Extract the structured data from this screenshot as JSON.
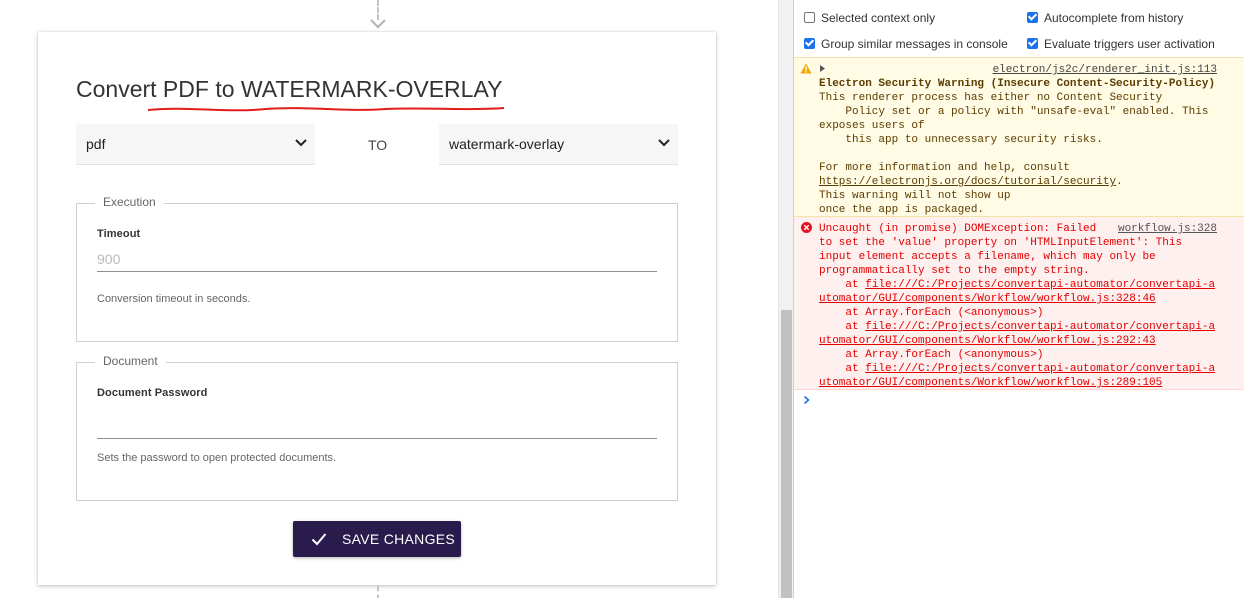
{
  "app": {
    "card_title": "Convert PDF to WATERMARK-OVERLAY",
    "from_format": "pdf",
    "to_label": "TO",
    "to_format": "watermark-overlay",
    "execution": {
      "legend": "Execution",
      "timeout_label": "Timeout",
      "timeout_placeholder": "900",
      "timeout_help": "Conversion timeout in seconds."
    },
    "document": {
      "legend": "Document",
      "password_label": "Document Password",
      "password_value": "",
      "password_help": "Sets the password to open protected documents."
    },
    "save_label": "SAVE CHANGES",
    "accent_color": "#2a1b4d"
  },
  "console": {
    "options": {
      "selected_context_only": {
        "label": "Selected context only",
        "checked": false
      },
      "autocomplete_from_history": {
        "label": "Autocomplete from history",
        "checked": true
      },
      "group_similar": {
        "label": "Group similar messages in console",
        "checked": true
      },
      "evaluate_triggers": {
        "label": "Evaluate triggers user activation",
        "checked": true
      }
    },
    "warning": {
      "source": "electron/js2c/renderer_init.js:113",
      "title": "Electron Security Warning (Insecure Content-Security-Policy)",
      "lines": [
        "This renderer process has either no Content Security",
        "    Policy set or a policy with \"unsafe-eval\" enabled. This",
        "exposes users of",
        "    this app to unnecessary security risks.",
        "",
        "For more information and help, consult"
      ],
      "link": "https://electronjs.org/docs/tutorial/security",
      "link_suffix": ".",
      "tail_lines": [
        "This warning will not show up",
        "once the app is packaged."
      ]
    },
    "error": {
      "source": "workflow.js:328",
      "first_line": "Uncaught (in promise) DOMException: Failed",
      "lines": [
        "to set the 'value' property on 'HTMLInputElement': This",
        "input element accepts a filename, which may only be",
        "programmatically set to the empty string."
      ],
      "stack": [
        {
          "prefix": "    at ",
          "link": "file:///C:/Projects/convertapi-automator/convertapi-a",
          "cont": "utomator/GUI/components/Workflow/workflow.js:328:46"
        },
        {
          "prefix": "    at Array.forEach (<anonymous>)",
          "link": "",
          "cont": ""
        },
        {
          "prefix": "    at ",
          "link": "file:///C:/Projects/convertapi-automator/convertapi-a",
          "cont": "utomator/GUI/components/Workflow/workflow.js:292:43"
        },
        {
          "prefix": "    at Array.forEach (<anonymous>)",
          "link": "",
          "cont": ""
        },
        {
          "prefix": "    at ",
          "link": "file:///C:/Projects/convertapi-automator/convertapi-a",
          "cont": "utomator/GUI/components/Workflow/workflow.js:289:105"
        }
      ]
    },
    "warning_color": "#fffbe5",
    "error_color": "#e40000"
  }
}
